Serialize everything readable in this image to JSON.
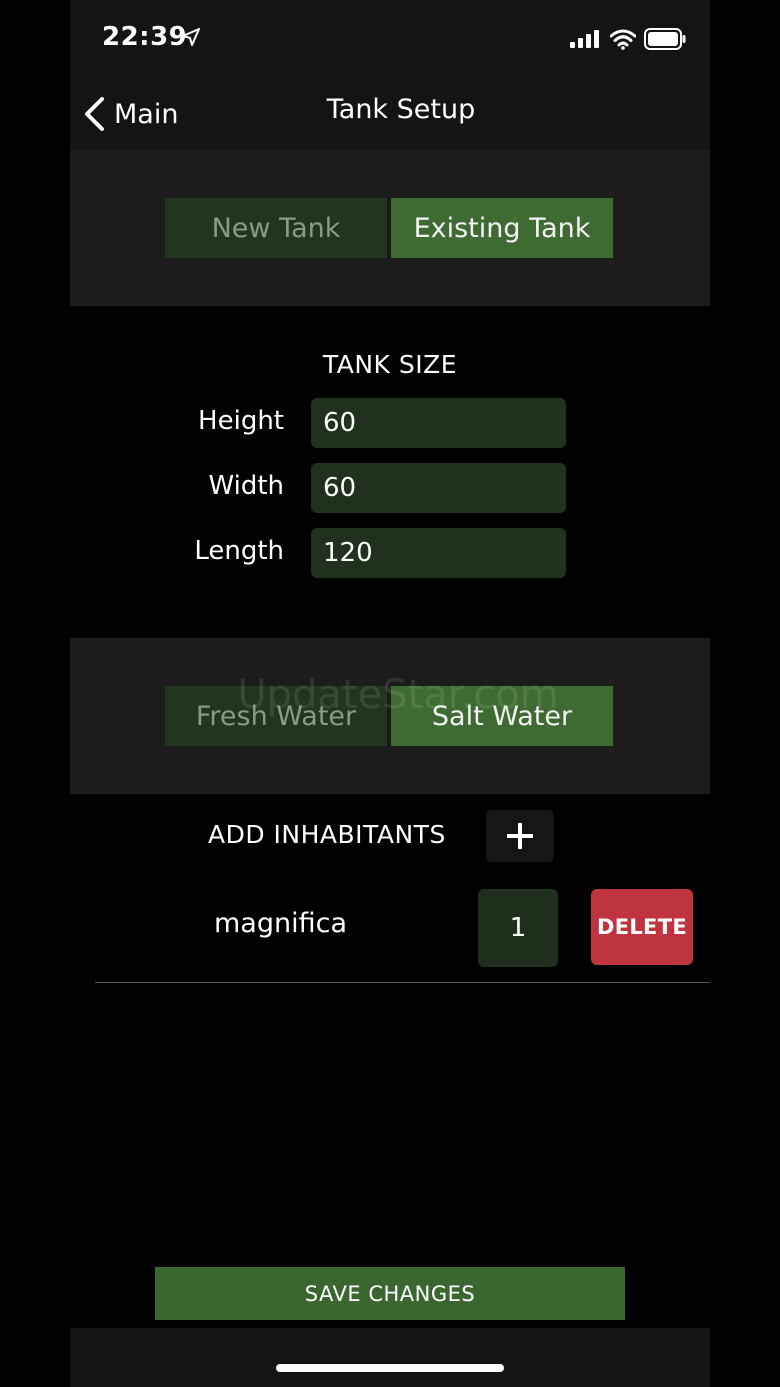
{
  "status_bar": {
    "time": "22:39"
  },
  "nav": {
    "back_label": "Main",
    "title": "Tank Setup"
  },
  "tank_type": {
    "options": [
      "New Tank",
      "Existing Tank"
    ],
    "selected": "Existing Tank"
  },
  "tank_size": {
    "title": "TANK SIZE",
    "fields": [
      {
        "label": "Height",
        "value": "60"
      },
      {
        "label": "Width",
        "value": "60"
      },
      {
        "label": "Length",
        "value": "120"
      }
    ]
  },
  "water_type": {
    "options": [
      "Fresh Water",
      "Salt Water"
    ],
    "selected": "Salt Water"
  },
  "watermark": "UpdateStar.com",
  "inhabitants": {
    "title": "ADD INHABITANTS",
    "items": [
      {
        "name": "magnifica",
        "quantity": "1",
        "delete_label": "DELETE"
      }
    ]
  },
  "save_label": "SAVE CHANGES",
  "colors": {
    "accent_active": "#3d6b32",
    "accent_inactive": "#22361f",
    "delete": "#c0343f",
    "panel": "#1c1c1c"
  }
}
